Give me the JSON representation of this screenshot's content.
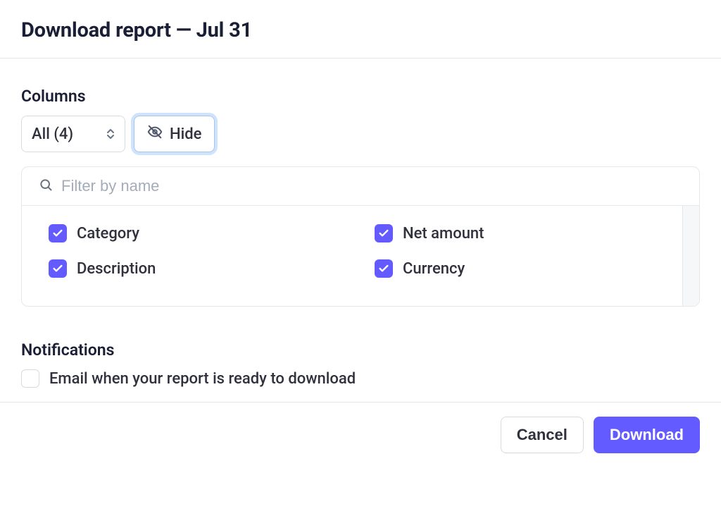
{
  "header": {
    "title": "Download report — Jul 31"
  },
  "columns": {
    "section_label": "Columns",
    "selector_label": "All (4)",
    "hide_label": "Hide",
    "filter_placeholder": "Filter by name",
    "items": [
      {
        "label": "Category",
        "checked": true
      },
      {
        "label": "Net amount",
        "checked": true
      },
      {
        "label": "Description",
        "checked": true
      },
      {
        "label": "Currency",
        "checked": true
      }
    ]
  },
  "notifications": {
    "section_label": "Notifications",
    "email_label": "Email when your report is ready to download",
    "email_checked": false
  },
  "footer": {
    "cancel_label": "Cancel",
    "download_label": "Download"
  }
}
